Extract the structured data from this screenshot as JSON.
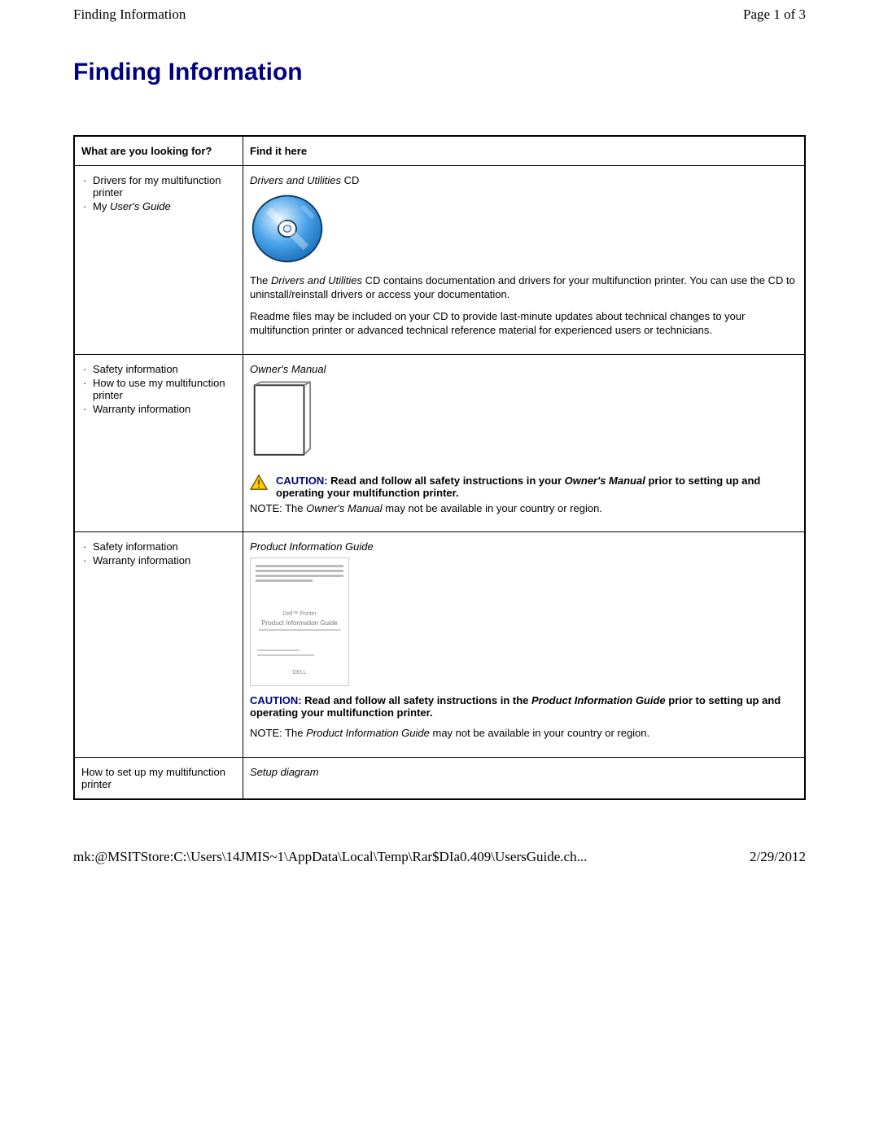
{
  "header": {
    "left": "Finding Information",
    "right": "Page 1 of 3"
  },
  "title": "Finding Information",
  "table": {
    "col_left_header": "What are you looking for?",
    "col_right_header": "Find it here",
    "rows": [
      {
        "left_bullets": [
          "Drivers for my multifunction printer",
          "My <i>User's Guide</i>"
        ],
        "right": {
          "resource_title": "<i>Drivers and Utilities</i> CD",
          "graphic": "cd",
          "paras": [
            "The <i>Drivers and Utilities</i> CD contains documentation and drivers for your multifunction printer. You can use the CD to uninstall/reinstall drivers or access your documentation.",
            "Readme files may be included on your CD to provide last-minute updates about technical changes to your multifunction printer or advanced technical reference material for experienced users or technicians."
          ]
        }
      },
      {
        "left_bullets": [
          "Safety information",
          "How to use my multifunction printer",
          "Warranty information"
        ],
        "right": {
          "resource_title": "<i>Owner's Manual</i>",
          "graphic": "manual",
          "caution_with_icon": {
            "label": "CAUTION:",
            "text": " Read and follow all safety instructions in your <i>Owner's Manual</i> prior to setting up and operating your multifunction printer."
          },
          "note": "NOTE: The <i>Owner's Manual</i> may not be available in your country or region."
        }
      },
      {
        "left_bullets": [
          "Safety information",
          "Warranty information"
        ],
        "right": {
          "resource_title": "<i>Product Information Guide</i>",
          "graphic": "pig",
          "caution_no_icon": {
            "label": "CAUTION:",
            "text": " Read and follow all safety instructions in the <i>Product Information Guide</i> prior to setting up and operating your multifunction printer."
          },
          "note": "NOTE: The <i>Product Information Guide</i> may not be available in your country or region."
        }
      },
      {
        "left_plain": "How to set up my multifunction printer",
        "right": {
          "resource_title": "<i>Setup diagram</i>"
        }
      }
    ]
  },
  "footer": {
    "left": "mk:@MSITStore:C:\\Users\\14JMIS~1\\AppData\\Local\\Temp\\Rar$DIa0.409\\UsersGuide.ch...",
    "right": "2/29/2012"
  }
}
